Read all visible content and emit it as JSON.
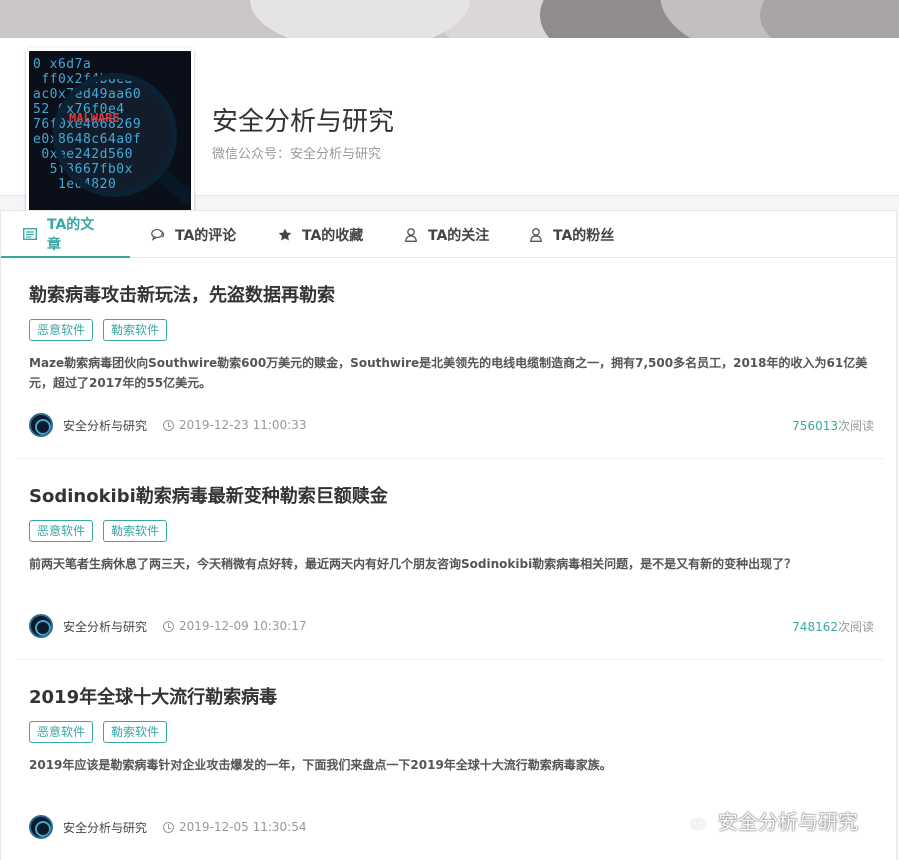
{
  "profile": {
    "name": "安全分析与研究",
    "subtitle": "微信公众号：安全分析与研究",
    "avatar_overlay_text": "MALWARE"
  },
  "tabs": [
    {
      "label": "TA的文章",
      "icon": "article-icon",
      "active": true
    },
    {
      "label": "TA的评论",
      "icon": "comment-icon",
      "active": false
    },
    {
      "label": "TA的收藏",
      "icon": "star-icon",
      "active": false
    },
    {
      "label": "TA的关注",
      "icon": "user-icon",
      "active": false
    },
    {
      "label": "TA的粉丝",
      "icon": "user-icon",
      "active": false
    }
  ],
  "articles": [
    {
      "title": "勒索病毒攻击新玩法，先盗数据再勒索",
      "tags": [
        "恶意软件",
        "勒索软件"
      ],
      "summary": "Maze勒索病毒团伙向Southwire勒索600万美元的赎金，Southwire是北美领先的电线电缆制造商之一，拥有7,500多名员工，2018年的收入为61亿美元，超过了2017年的55亿美元。",
      "author": "安全分析与研究",
      "time": "2019-12-23 11:00:33",
      "reads": "756013",
      "reads_suffix": "次阅读"
    },
    {
      "title": "Sodinokibi勒索病毒最新变种勒索巨额赎金",
      "tags": [
        "恶意软件",
        "勒索软件"
      ],
      "summary": "前两天笔者生病休息了两三天，今天稍微有点好转，最近两天内有好几个朋友咨询Sodinokibi勒索病毒相关问题，是不是又有新的变种出现了？",
      "author": "安全分析与研究",
      "time": "2019-12-09 10:30:17",
      "reads": "748162",
      "reads_suffix": "次阅读"
    },
    {
      "title": "2019年全球十大流行勒索病毒",
      "tags": [
        "恶意软件",
        "勒索软件"
      ],
      "summary": "2019年应该是勒索病毒针对企业攻击爆发的一年，下面我们来盘点一下2019年全球十大流行勒索病毒家族。",
      "author": "安全分析与研究",
      "time": "2019-12-05 11:30:54",
      "reads": "",
      "reads_suffix": ""
    }
  ],
  "watermark": {
    "text": "安全分析与研究",
    "icon": "wechat-icon"
  },
  "colors": {
    "accent": "#3aa7a4",
    "text": "#333333",
    "muted": "#999999"
  }
}
